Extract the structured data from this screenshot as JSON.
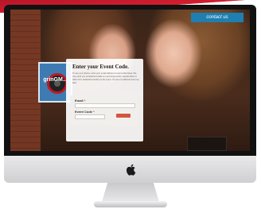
{
  "header": {
    "contact_label": "contact us"
  },
  "logo": {
    "text": "grinGM..."
  },
  "form": {
    "title": "Enter your Event Code.",
    "description": "To see your photos, enter your email address & event code below. We may send you occasional emails on upcoming events, special offers or offers from dedicated vendors to the event. You are not affected and may later.",
    "email_label": "Email",
    "event_code_label": "Event Code",
    "required_mark": "*",
    "email_value": "",
    "event_code_value": ""
  },
  "colors": {
    "ribbon": "#d21f2f",
    "contact_bg": "#1e7fb0",
    "submit_bg": "#d4563c",
    "logo_bg": "#3d7bb2"
  }
}
